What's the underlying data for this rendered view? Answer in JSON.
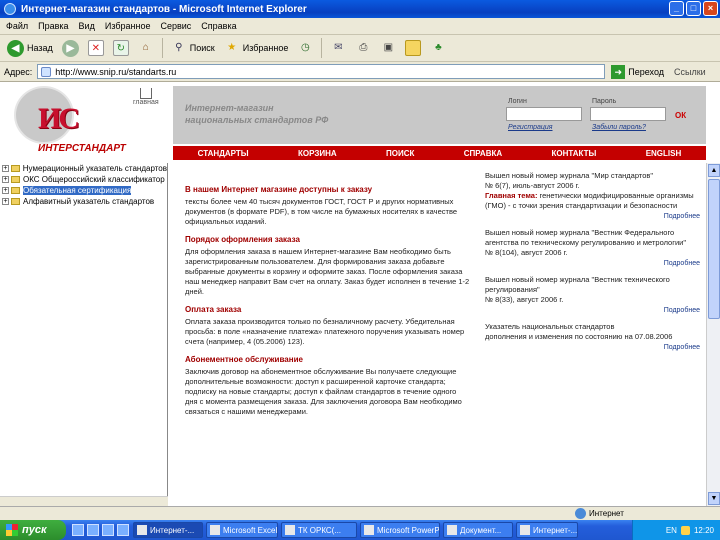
{
  "window": {
    "title": "Интернет-магазин стандартов - Microsoft Internet Explorer"
  },
  "menu": [
    "Файл",
    "Правка",
    "Вид",
    "Избранное",
    "Сервис",
    "Справка"
  ],
  "toolbar": {
    "back": "Назад",
    "search": "Поиск",
    "favorites": "Избранное"
  },
  "address": {
    "label": "Адрес:",
    "url": "http://www.snip.ru/standarts.ru",
    "go": "Переход",
    "links": "Ссылки"
  },
  "tree": [
    {
      "label": "Нумерационный указатель стандартов",
      "selected": false
    },
    {
      "label": "ОКС Общероссийский классификатор",
      "selected": false
    },
    {
      "label": "Обязательная сертификация",
      "selected": true
    },
    {
      "label": "Алфавитный указатель стандартов",
      "selected": false
    }
  ],
  "site": {
    "logo_name": "ИНТЕРСТАНДАРТ",
    "home": "главная",
    "tagline": [
      "Интернет-магазин",
      "национальных стандартов РФ"
    ],
    "login_label": "Логин",
    "password_label": "Пароль",
    "ok": "ОК",
    "register": "Регистрация",
    "forgot": "Забыли пароль?",
    "nav": [
      "СТАНДАРТЫ",
      "КОРЗИНА",
      "ПОИСК",
      "СПРАВКА",
      "КОНТАКТЫ",
      "ENGLISH"
    ]
  },
  "sections": [
    {
      "title": "В нашем Интернет магазине доступны к заказу",
      "body": "тексты более чем 40 тысяч документов ГОСТ, ГОСТ Р и других нормативных документов (в формате PDF), в том числе на бумажных носителях в качестве официальных изданий."
    },
    {
      "title": "Порядок оформления заказа",
      "body": "Для оформления заказа в нашем Интернет-магазине Вам необходимо быть зарегистрированным пользователем. Для формирования заказа добавьте выбранные документы в корзину и оформите заказ. После оформления заказа наш менеджер направит Вам счет на оплату. Заказ будет исполнен в течение 1-2 дней."
    },
    {
      "title": "Оплата заказа",
      "body": "Оплата заказа производится только по безналичному расчету. Убедительная просьба: в поле «назначение платежа» платежного поручения указывать номер счета (например, 4 (05.2006) 123)."
    },
    {
      "title": "Абонементное обслуживание",
      "body": "Заключив договор на абонементное обслуживание Вы получаете следующие дополнительные возможности: доступ к расширенной карточке стандарта; подписку на новые стандарты; доступ к файлам стандартов в течение одного дня с момента размещения заказа. Для заключения договора Вам необходимо связаться с нашими менеджерами."
    }
  ],
  "news": [
    {
      "title": "Вышел новый номер журнала \"Мир стандартов\"",
      "issue": "№ 6(7), июль-август 2006 г.",
      "theme_label": "Главная тема:",
      "theme": "генетически модифицированные организмы (ГМО) - с точки зрения стандартизации и безопасности",
      "more": "Подробнее"
    },
    {
      "title": "Вышел новый номер журнала \"Вестник Федерального агентства по техническому регулированию и метрологии\"",
      "issue": "№ 8(104), август 2006 г.",
      "more": "Подробнее"
    },
    {
      "title": "Вышел новый номер журнала \"Вестник технического регулирования\"",
      "issue": "№ 8(33), август 2006 г.",
      "more": "Подробнее"
    },
    {
      "title": "Указатель национальных стандартов",
      "issue": "дополнения и изменения по состоянию на 07.08.2006",
      "more": "Подробнее"
    }
  ],
  "status": {
    "zone": "Интернет"
  },
  "taskbar": {
    "start": "пуск",
    "tasks": [
      "Интернет-...",
      "Microsoft Excel",
      "ТК ОРКС(...",
      "Microsoft PowerP...",
      "Документ...",
      "Интернет-..."
    ],
    "tray_lang": "EN",
    "clock": "12:20"
  }
}
